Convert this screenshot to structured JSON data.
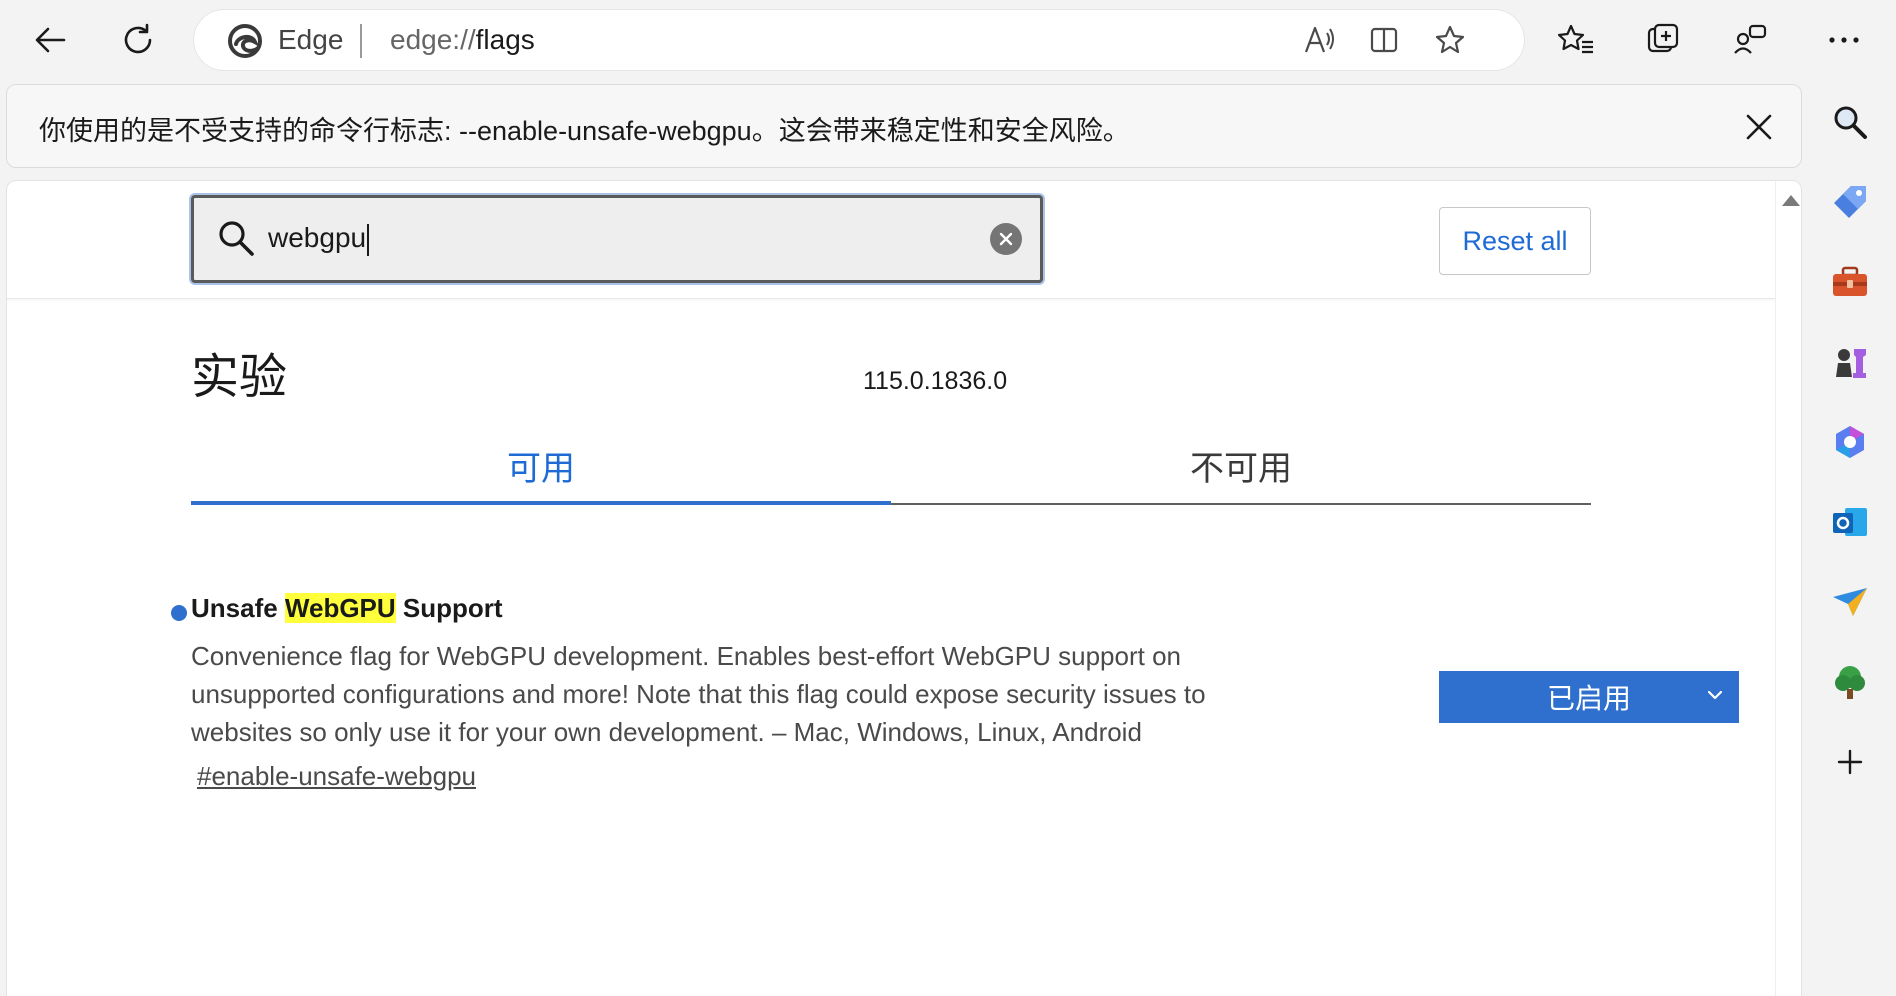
{
  "toolbar": {
    "address": {
      "site_label": "Edge",
      "url_scheme": "edge://",
      "url_path": "flags"
    }
  },
  "infobar": {
    "message": "你使用的是不受支持的命令行标志: --enable-unsafe-webgpu。这会带来稳定性和安全风险。"
  },
  "search": {
    "value": "webgpu",
    "placeholder": "Search flags"
  },
  "reset_all_label": "Reset all",
  "page_title": "实验",
  "version": "115.0.1836.0",
  "tabs": [
    {
      "label": "可用",
      "active": true
    },
    {
      "label": "不可用",
      "active": false
    }
  ],
  "flag": {
    "name_prefix": "Unsafe ",
    "name_highlight": "WebGPU",
    "name_suffix": " Support",
    "description": "Convenience flag for WebGPU development. Enables best-effort WebGPU support on unsupported configurations and more! Note that this flag could expose security issues to websites so only use it for your own development. – Mac, Windows, Linux, Android",
    "anchor": "#enable-unsafe-webgpu",
    "state": "已启用"
  },
  "colors": {
    "accent": "#2f6fce",
    "link_blue": "#1f6bd6",
    "highlight": "#ffff3c"
  },
  "sidebar_icons": [
    "search-icon",
    "tag-icon",
    "briefcase-icon",
    "chess-icon",
    "copilot-icon",
    "outlook-icon",
    "send-icon",
    "tree-icon",
    "add-icon"
  ]
}
